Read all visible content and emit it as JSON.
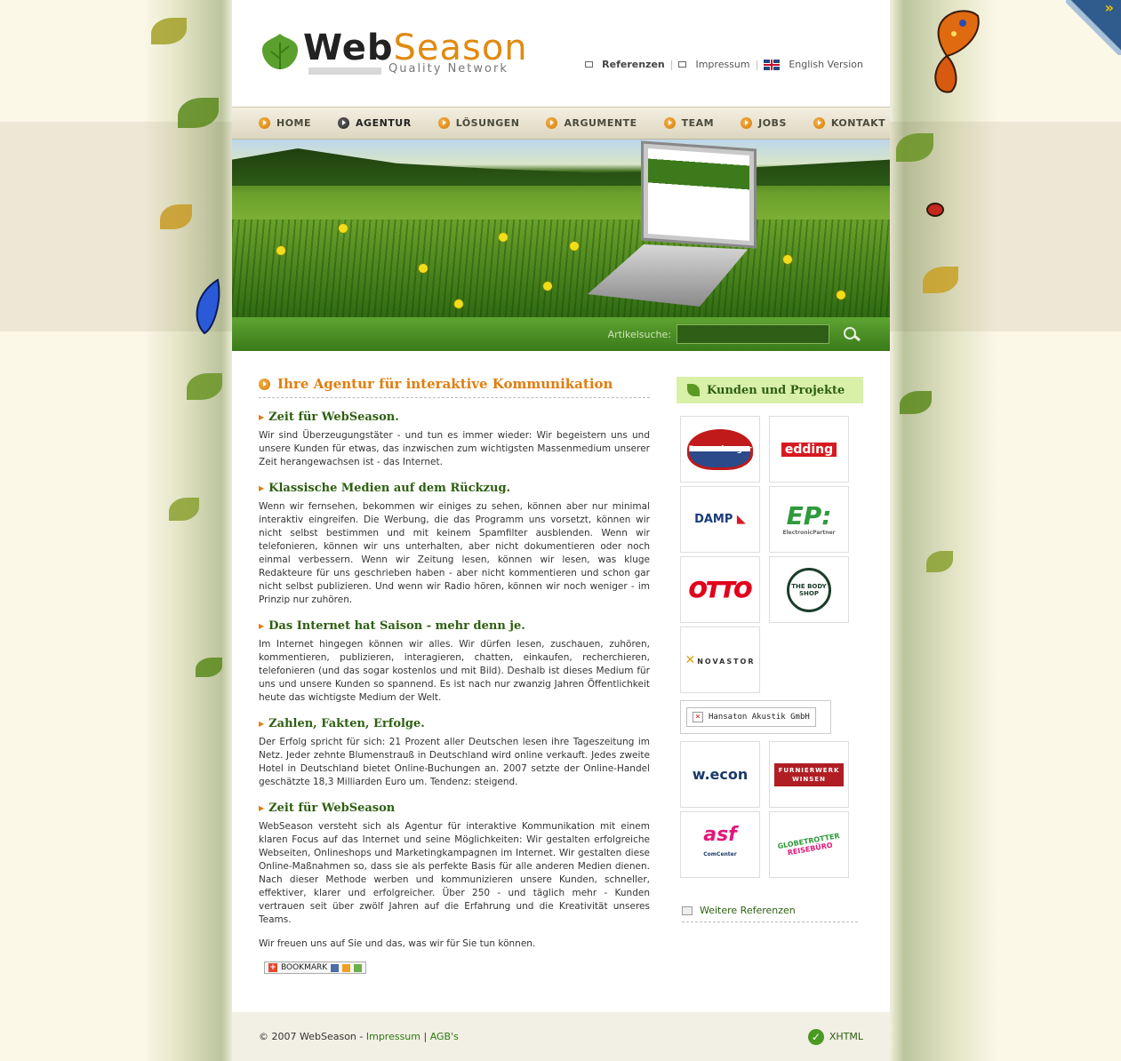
{
  "header": {
    "logo_main": "Web",
    "logo_accent": "Season",
    "logo_tagline": "Quality Network",
    "top_links": [
      {
        "label": "Referenzen",
        "bold": true
      },
      {
        "label": "Impressum",
        "bold": false
      },
      {
        "label": "English Version",
        "bold": false
      }
    ]
  },
  "nav": {
    "items": [
      {
        "label": "HOME",
        "active": false
      },
      {
        "label": "AGENTUR",
        "active": true
      },
      {
        "label": "LÖSUNGEN",
        "active": false
      },
      {
        "label": "ARGUMENTE",
        "active": false
      },
      {
        "label": "TEAM",
        "active": false
      },
      {
        "label": "JOBS",
        "active": false
      },
      {
        "label": "KONTAKT",
        "active": false
      }
    ]
  },
  "search": {
    "label": "Artikelsuche:",
    "value": "",
    "button_icon": "search-icon"
  },
  "main": {
    "title": "Ihre Agentur für interaktive Kommunikation",
    "sections": [
      {
        "heading": "Zeit für WebSeason.",
        "text": "Wir sind Überzeugungstäter - und tun es immer wieder: Wir begeistern uns und unsere Kunden für etwas, das inzwischen zum wichtigsten Massenmedium unserer Zeit herangewachsen ist - das Internet."
      },
      {
        "heading": "Klassische Medien auf dem Rückzug.",
        "text": "Wenn wir fernsehen, bekommen wir einiges zu sehen, können aber nur minimal interaktiv eingreifen. Die Werbung, die das Programm uns vorsetzt, können wir nicht selbst bestimmen und mit keinem Spamfilter ausblenden. Wenn wir telefonieren, können wir uns unterhalten, aber nicht dokumentieren oder noch einmal verbessern. Wenn wir Zeitung lesen, können wir lesen, was kluge Redakteure für uns geschrieben haben - aber nicht kommentieren und schon gar nicht selbst publizieren. Und wenn wir Radio hören, können wir noch weniger - im Prinzip nur zuhören."
      },
      {
        "heading": "Das Internet hat Saison - mehr denn je.",
        "text": "Im Internet hingegen können wir alles. Wir dürfen lesen, zuschauen, zuhören, kommentieren, publizieren, interagieren, chatten, einkaufen, recherchieren, telefonieren (und das sogar kostenlos und mit Bild). Deshalb ist dieses Medium für uns und unsere Kunden so spannend. Es ist nach nur zwanzig Jahren Öffentlichkeit heute das wichtigste Medium der Welt."
      },
      {
        "heading": "Zahlen, Fakten, Erfolge.",
        "text": "Der Erfolg spricht für sich: 21 Prozent aller Deutschen lesen ihre Tageszeitung im Netz. Jeder zehnte Blumenstrauß in Deutschland wird online verkauft. Jedes zweite Hotel in Deutschland bietet Online-Buchungen an. 2007 setzte der Online-Handel geschätzte 18,3 Milliarden Euro um. Tendenz: steigend."
      },
      {
        "heading": "Zeit für WebSeason",
        "text": "WebSeason versteht sich als Agentur für interaktive Kommunikation mit einem klaren Focus auf das Internet und seine Möglichkeiten: Wir gestalten erfolgreiche Webseiten, Onlineshops und Marketingkampagnen im Internet. Wir gestalten diese Online-Maßnahmen so, dass sie als perfekte Basis für alle anderen Medien dienen. Nach dieser Methode werben und kommunizieren unsere Kunden, schneller, effektiver, klarer und erfolgreicher. Über 250 - und täglich mehr - Kunden vertrauen seit über zwölf Jahren auf die Erfahrung und die Kreativität unseres Teams."
      }
    ],
    "closing": "Wir freuen uns auf Sie und das, was wir für Sie tun können.",
    "bookmark_label": "BOOKMARK"
  },
  "sidebar": {
    "title": "Kunden und Projekte",
    "logos": {
      "ravensburger": "Ravensburger",
      "edding": "edding",
      "damp": "DAMP",
      "ep": "EP:",
      "ep_sub": "ElectronicPartner",
      "otto": "OTTO",
      "bodyshop": "THE BODY SHOP",
      "novastor": "NOVASTOR",
      "hansaton": "Hansaton Akustik GmbH",
      "wecon": "w.econ",
      "furnier1": "FURNIERWERK",
      "furnier2": "WINSEN",
      "asf": "asf",
      "asf_sub": "ComCenter",
      "globe1": "GLOBETROTTER",
      "globe2": "REISEBÜRO"
    },
    "more_link": "Weitere Referenzen"
  },
  "footer": {
    "copyright": "© 2007 WebSeason - ",
    "impressum": "Impressum",
    "separator": " | ",
    "agb": "AGB's",
    "badge": "XHTML"
  },
  "colors": {
    "accent_orange": "#e07e10",
    "heading_green": "#2d5f10",
    "nav_bg": "#ddd6bf",
    "search_green": "#4a8a22"
  }
}
